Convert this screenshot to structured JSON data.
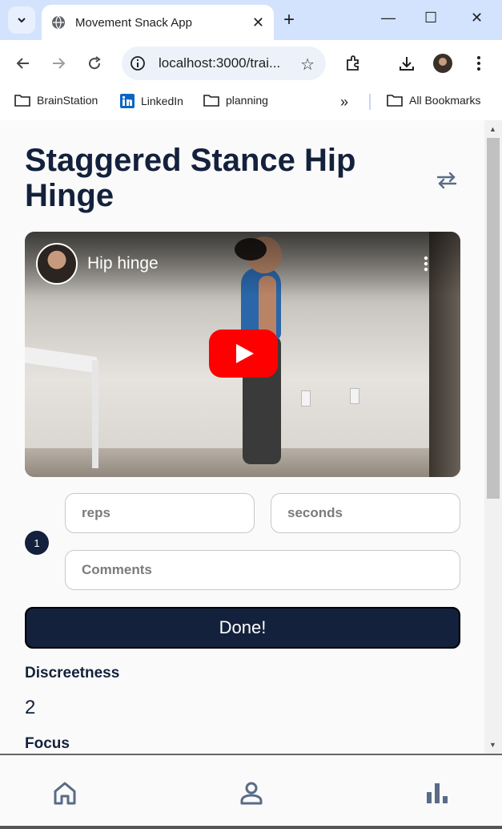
{
  "browser": {
    "tab_title": "Movement Snack App",
    "url": "localhost:3000/trai...",
    "bookmarks": [
      "BrainStation",
      "LinkedIn",
      "planning",
      "All Bookmarks"
    ],
    "icons": [
      "chevron-down-icon",
      "globe-icon",
      "close-icon",
      "plus-icon",
      "minimize-icon",
      "maximize-icon",
      "close-window-icon",
      "back-icon",
      "forward-icon",
      "reload-icon",
      "info-icon",
      "star-icon",
      "extensions-icon",
      "download-icon",
      "profile-avatar",
      "more-vert-icon",
      "folder-icon",
      "linkedin-icon",
      "overflow-chevrons-icon"
    ]
  },
  "page": {
    "title": "Staggered Stance Hip Hinge",
    "video": {
      "title": "Hip hinge"
    },
    "set_number": "1",
    "inputs": {
      "reps_placeholder": "reps",
      "seconds_placeholder": "seconds",
      "comments_placeholder": "Comments"
    },
    "done_label": "Done!",
    "stats": [
      {
        "label": "Discreetness",
        "value": "2"
      },
      {
        "label": "Focus",
        "value": ""
      }
    ]
  },
  "bottom_nav": {
    "items": [
      "home-icon",
      "profile-icon",
      "stats-icon"
    ]
  },
  "colors": {
    "primary": "#13213c",
    "tabstrip": "#d3e3fd",
    "youtube_red": "#ff0000"
  }
}
